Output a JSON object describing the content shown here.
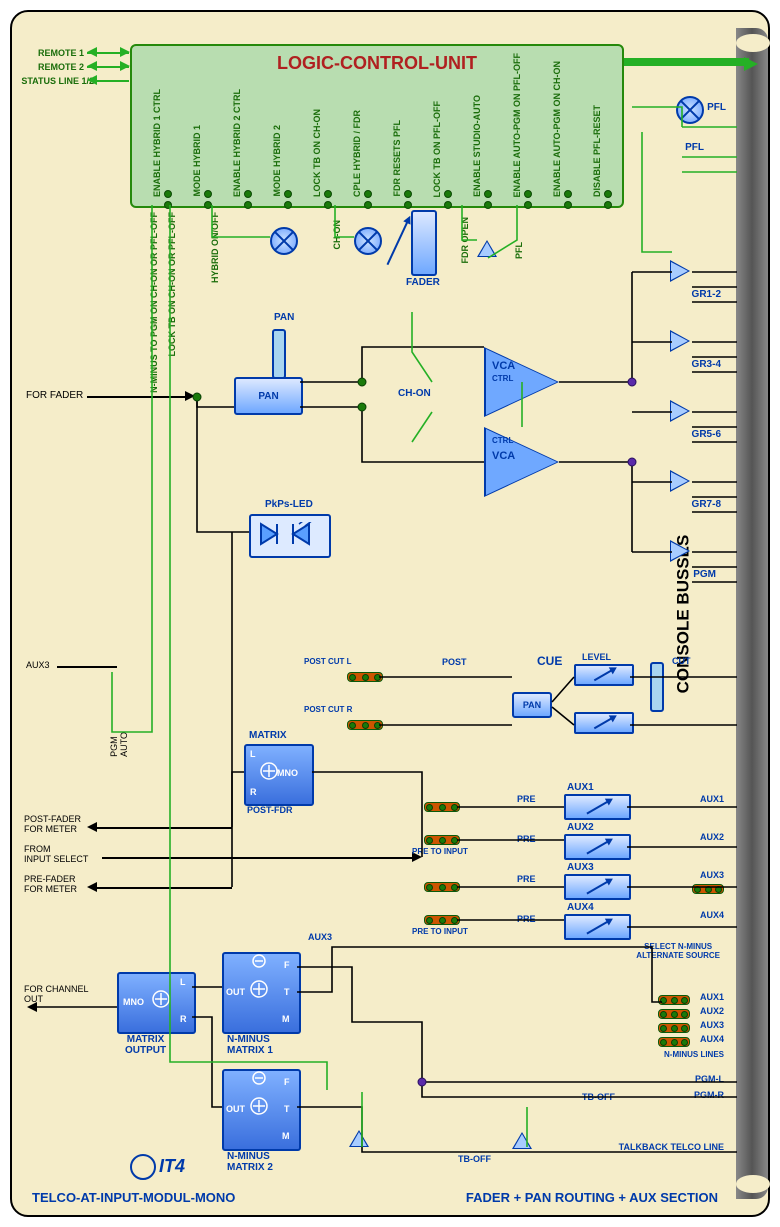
{
  "title": "TELCO-AT-INPUT-MODUL-MONO",
  "section": "FADER + PAN  ROUTING + AUX SECTION",
  "product": "IT4",
  "lcu": {
    "title": "LOGIC-CONTROL-UNIT",
    "pins": [
      "ENABLE HYBRID 1 CTRL",
      "MODE HYBRID 1",
      "ENABLE HYBRID 2 CTRL",
      "MODE HYBRID 2",
      "LOCK TB ON CH-ON",
      "CPLE HYBRID / FDR",
      "FDR RESETS PFL",
      "LOCK TB ON PFL-OFF",
      "ENABLE STUDIO-AUTO",
      "ENABLE AUTO-PGM ON PFL-OFF",
      "ENABLE AUTO-PGM ON CH-ON",
      "DISABLE PFL-RESET"
    ]
  },
  "ext_labels": {
    "remote1": "REMOTE 1",
    "remote2": "REMOTE 2",
    "status": "STATUS LINE 1/2"
  },
  "left_io": {
    "for_fader": "FOR FADER",
    "aux3": "AUX3",
    "pgm_auto": "PGM\nAUTO",
    "post_fader": "POST-FADER\nFOR METER",
    "from_input": "FROM\nINPUT SELECT",
    "pre_fader": "PRE-FADER\nFOR METER",
    "for_channel": "FOR CHANNEL\nOUT"
  },
  "blocks": {
    "pan": "PAN",
    "pan2": "PAN",
    "pkps": "PkPs-LED",
    "fader": "FADER",
    "matrix": "MATRIX",
    "post_fdr": "POST-FDR",
    "matrix_out": "MATRIX\nOUTPUT",
    "nminus1": "N-MINUS\nMATRIX 1",
    "nminus2": "N-MINUS\nMATRIX 2",
    "vca1": "VCA",
    "vca2": "VCA",
    "ctrl": "CTRL",
    "mno": "MNO",
    "l": "L",
    "r": "R",
    "out": "OUT",
    "f": "F",
    "t": "T",
    "m": "M",
    "cue": "CUE",
    "level": "LEVEL",
    "cut": "CUT",
    "post": "POST",
    "pre": "PRE",
    "postcutl": "POST CUT L",
    "postcutr": "POST CUT R",
    "pretoinput": "PRE TO INPUT",
    "aux1": "AUX1",
    "aux2": "AUX2",
    "aux3b": "AUX3",
    "aux4": "AUX4",
    "sel_nminus": "SELECT N-MINUS\nALTERNATE SOURCE",
    "nminus_lines": "N-MINUS LINES",
    "pgm_l": "PGM-L",
    "pgm_r": "PGM-R",
    "tb_off": "TB-OFF",
    "talkback": "TALKBACK TELCO LINE"
  },
  "logic_labels": {
    "nminus_pgm": "N-MINUS TO PGM ON CH-ON OR PFL-OFF",
    "lock_tb": "LOCK TB ON CH-ON OR PFL-OFF",
    "hybrid_onoff": "HYBRID ON/OFF",
    "ch_on": "CH-ON",
    "fdr_open": "FDR OPEN",
    "pfl": "PFL"
  },
  "bus": {
    "title": "CONSOLE BUSSES",
    "pfl": "PFL",
    "gr12": "GR1-2",
    "gr34": "GR3-4",
    "gr56": "GR5-6",
    "gr78": "GR7-8",
    "pgm": "PGM"
  }
}
